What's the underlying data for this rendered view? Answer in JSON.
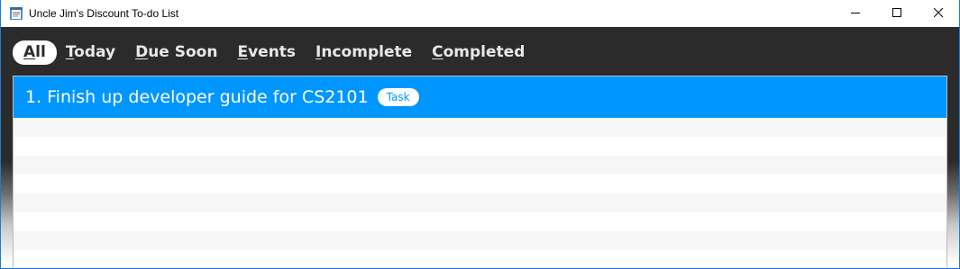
{
  "window": {
    "title": "Uncle Jim's Discount To-do List",
    "accent": "#0096ff",
    "dark_background": "#2b2b2b"
  },
  "icons": {
    "app": "app-notepad-icon",
    "minimize": "minimize-icon",
    "maximize": "maximize-icon",
    "close": "close-icon"
  },
  "tabs": [
    {
      "accel": "A",
      "rest": "ll",
      "active": true
    },
    {
      "accel": "T",
      "rest": "oday",
      "active": false
    },
    {
      "accel": "D",
      "rest": "ue Soon",
      "active": false
    },
    {
      "accel": "E",
      "rest": "vents",
      "active": false
    },
    {
      "accel": "I",
      "rest": "ncomplete",
      "active": false
    },
    {
      "accel": "C",
      "rest": "ompleted",
      "active": false
    }
  ],
  "tasks": [
    {
      "index": "1.",
      "title": "Finish up developer guide for CS2101",
      "tag": "Task"
    }
  ]
}
